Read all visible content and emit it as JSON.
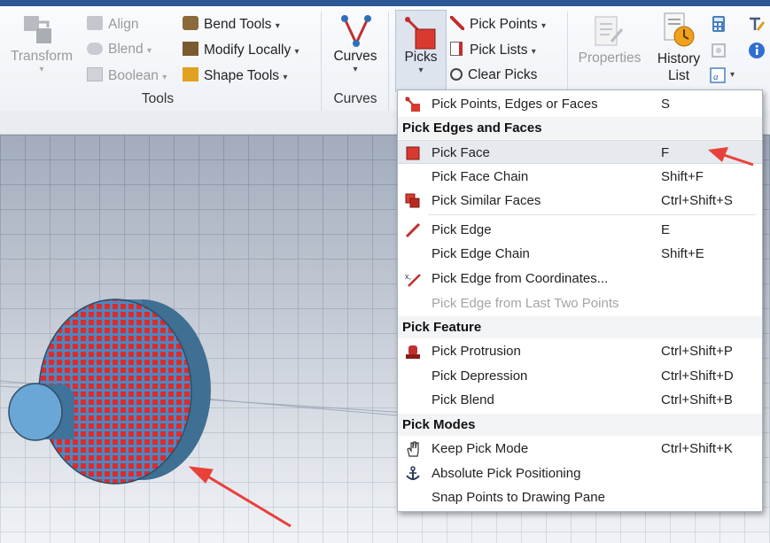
{
  "ribbon": {
    "transform": "Transform",
    "align": "Align",
    "blend": "Blend",
    "boolean": "Boolean",
    "bend_tools": "Bend Tools",
    "modify_locally": "Modify Locally",
    "shape_tools": "Shape Tools",
    "tools_group": "Tools",
    "curves_button": "Curves",
    "curves_group": "Curves",
    "picks_button": "Picks",
    "pick_points": "Pick Points",
    "pick_lists": "Pick Lists",
    "clear_picks": "Clear Picks",
    "properties": "Properties",
    "history_list_line1": "History",
    "history_list_line2": "List"
  },
  "menu": {
    "top_item": {
      "label": "Pick Points, Edges or Faces",
      "shortcut": "S"
    },
    "header_edges_faces": "Pick Edges and Faces",
    "pick_face": {
      "label": "Pick Face",
      "shortcut": "F"
    },
    "pick_face_chain": {
      "label": "Pick Face Chain",
      "shortcut": "Shift+F"
    },
    "pick_similar_faces": {
      "label": "Pick Similar Faces",
      "shortcut": "Ctrl+Shift+S"
    },
    "pick_edge": {
      "label": "Pick Edge",
      "shortcut": "E"
    },
    "pick_edge_chain": {
      "label": "Pick Edge Chain",
      "shortcut": "Shift+E"
    },
    "pick_edge_coords": {
      "label": "Pick Edge from Coordinates...",
      "shortcut": ""
    },
    "pick_edge_last_two": {
      "label": "Pick Edge from Last Two Points",
      "shortcut": ""
    },
    "header_feature": "Pick Feature",
    "pick_protrusion": {
      "label": "Pick Protrusion",
      "shortcut": "Ctrl+Shift+P"
    },
    "pick_depression": {
      "label": "Pick Depression",
      "shortcut": "Ctrl+Shift+D"
    },
    "pick_blend": {
      "label": "Pick Blend",
      "shortcut": "Ctrl+Shift+B"
    },
    "header_modes": "Pick Modes",
    "keep_pick_mode": {
      "label": "Keep Pick Mode",
      "shortcut": "Ctrl+Shift+K"
    },
    "absolute_pick": {
      "label": "Absolute Pick Positioning",
      "shortcut": ""
    },
    "snap_points": {
      "label": "Snap Points to Drawing Pane",
      "shortcut": ""
    }
  },
  "colors": {
    "accent_bar": "#2b5797",
    "pick_red": "#d62b2b",
    "annotation_arrow": "#e8413a",
    "cylinder_blue": "#6aa6d6"
  }
}
